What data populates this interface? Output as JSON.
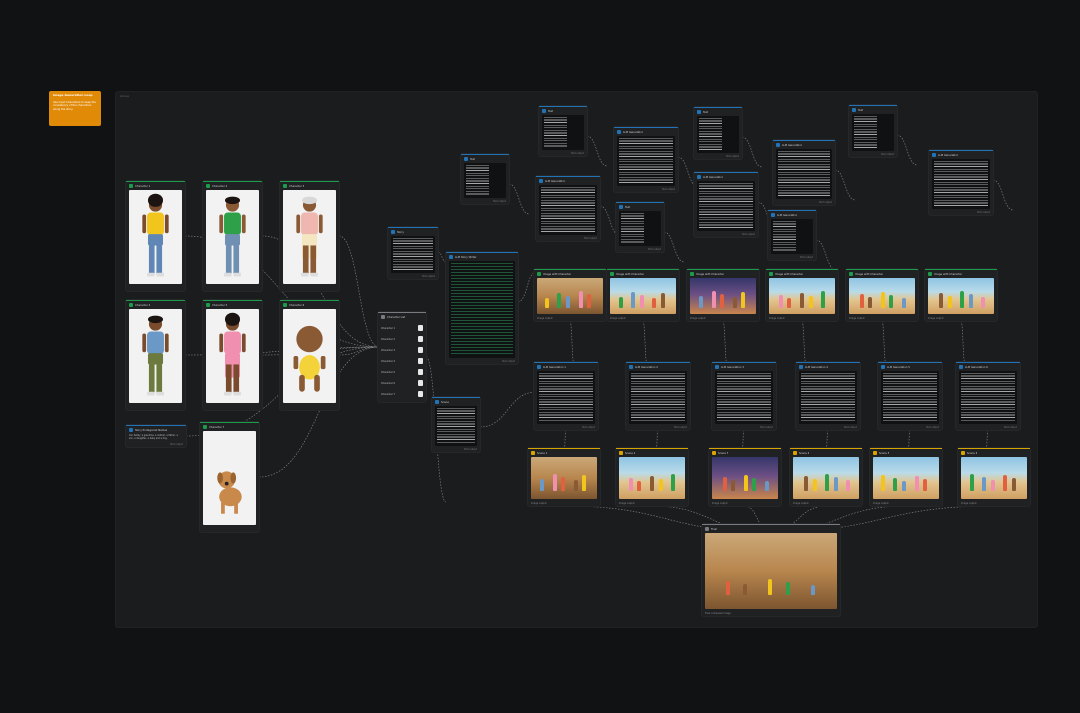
{
  "sticky": {
    "title": "Image Generation Loop",
    "text": "Use input Characters to keep the consistency of the characters along the story."
  },
  "canvas": {
    "label": "Group"
  },
  "characters": [
    {
      "label": "Character 1",
      "shirt": "#f2c51d",
      "pants": "#5f86b5",
      "skin": "#7a4b2c",
      "hair": "#1b1411"
    },
    {
      "label": "Character 2",
      "shirt": "#2fa04a",
      "pants": "#6f8fb3",
      "skin": "#8a5a35",
      "hair": "#1b1411"
    },
    {
      "label": "Character 3",
      "shirt": "#f0b6b0",
      "pants": "#f4e6c0",
      "skin": "#8a5a35",
      "hair": "#d8d8d8"
    },
    {
      "label": "Character 4",
      "shirt": "#6a98c7",
      "pants": "#6c7a3e",
      "skin": "#7a4b2c",
      "hair": "#1b1411"
    },
    {
      "label": "Character 5",
      "shirt": "#f08fb0",
      "pants": "#f08fb0",
      "skin": "#7a4b2c",
      "hair": "#1b1411"
    },
    {
      "label": "Character 6",
      "shirt": "#f4d33a",
      "pants": "#f4d33a",
      "skin": "#8a5a35",
      "hair": "#3a2414"
    },
    {
      "label": "Character 7",
      "shirt": "#c8894a",
      "pants": "#c8894a",
      "skin": "#c8894a",
      "hair": "#9a6430"
    }
  ],
  "description_node": {
    "label": "Story Protagonist Names",
    "text": "Our family: a grandma, a mother, a father, a son, a daughter, a baby and a dog."
  },
  "list_node": {
    "label": "Character List",
    "items": [
      "Character 1",
      "Character 2",
      "Character 3",
      "Character 4",
      "Character 5",
      "Character 6",
      "Character 7"
    ]
  },
  "text_nodes": {
    "story_prompt": {
      "label": "Story"
    },
    "llm_story": {
      "label": "LLM Story Writer"
    },
    "scene_prompt": {
      "label": "Scene"
    },
    "output": {
      "label": "Output"
    }
  },
  "top_text": [
    {
      "label": "Text"
    },
    {
      "label": "LLM Generation"
    },
    {
      "label": "Text"
    },
    {
      "label": "LLM Generation"
    },
    {
      "label": "Text"
    },
    {
      "label": "LLM Generation"
    },
    {
      "label": "Text"
    },
    {
      "label": "LLM Generation"
    },
    {
      "label": "Text"
    },
    {
      "label": "LLM Generation"
    },
    {
      "label": "LLM Generation"
    }
  ],
  "gen_row1": [
    "Image with Character",
    "Image with Character",
    "Image with Character",
    "Image with Character",
    "Image with Character",
    "Image with Character"
  ],
  "llm_row2": [
    "LLM Generation 1",
    "LLM Generation 2",
    "LLM Generation 3",
    "LLM Generation 4",
    "LLM Generation 5",
    "LLM Generation 6"
  ],
  "gen_row3": [
    "Scene 1",
    "Scene 2",
    "Scene 3",
    "Scene 4",
    "Scene 5",
    "Scene 6"
  ],
  "final": {
    "label": "Final",
    "caption": "Final composed image"
  },
  "foot_text": "Text output",
  "foot_image": "Image output"
}
